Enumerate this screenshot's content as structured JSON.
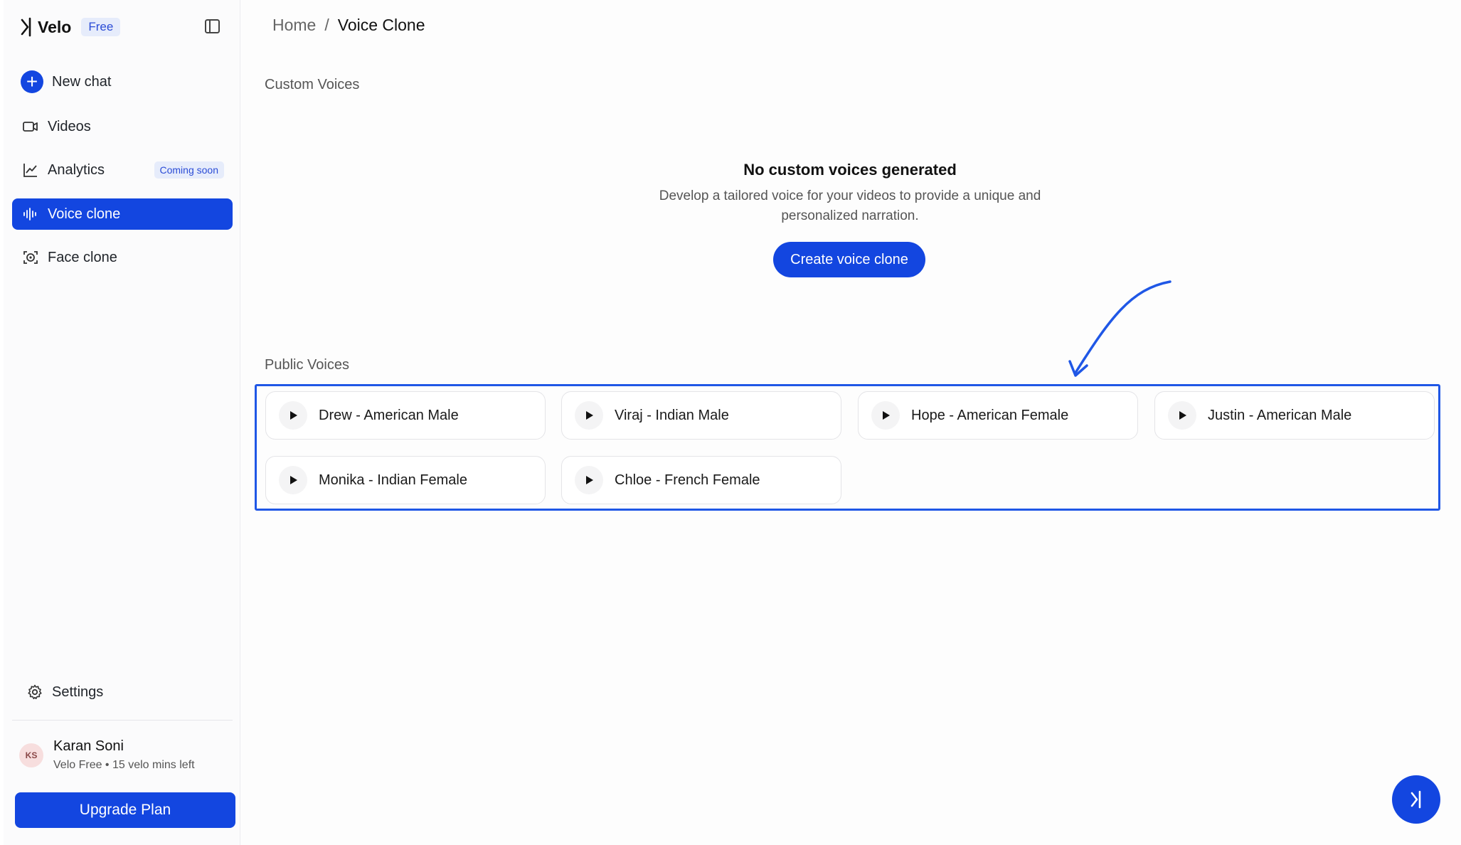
{
  "brand": {
    "name": "Velo",
    "badge": "Free"
  },
  "sidebar": {
    "items": [
      {
        "label": "New chat",
        "icon": "plus-circle-icon"
      },
      {
        "label": "Videos",
        "icon": "video-icon"
      },
      {
        "label": "Analytics",
        "icon": "chart-line-icon",
        "badge": "Coming soon"
      },
      {
        "label": "Voice clone",
        "icon": "waveform-icon",
        "active": true
      },
      {
        "label": "Face clone",
        "icon": "face-scan-icon"
      }
    ],
    "settings_label": "Settings"
  },
  "user": {
    "initials": "KS",
    "name": "Karan Soni",
    "plan_info": "Velo Free • 15 velo mins left"
  },
  "upgrade_label": "Upgrade Plan",
  "breadcrumb": {
    "home": "Home",
    "separator": "/",
    "current": "Voice Clone"
  },
  "custom_voices": {
    "section_label": "Custom Voices",
    "empty_title": "No custom voices generated",
    "empty_desc_line1": "Develop a tailored voice for your videos to provide a unique and",
    "empty_desc_line2": "personalized narration.",
    "create_label": "Create voice clone"
  },
  "public_voices": {
    "section_label": "Public Voices",
    "voices": [
      "Drew - American Male",
      "Viraj - Indian Male",
      "Hope - American Female",
      "Justin - American Male",
      "Monika - Indian Female",
      "Chloe - French Female"
    ]
  },
  "colors": {
    "accent": "#1346e0",
    "highlight_border": "#1f57e6"
  }
}
